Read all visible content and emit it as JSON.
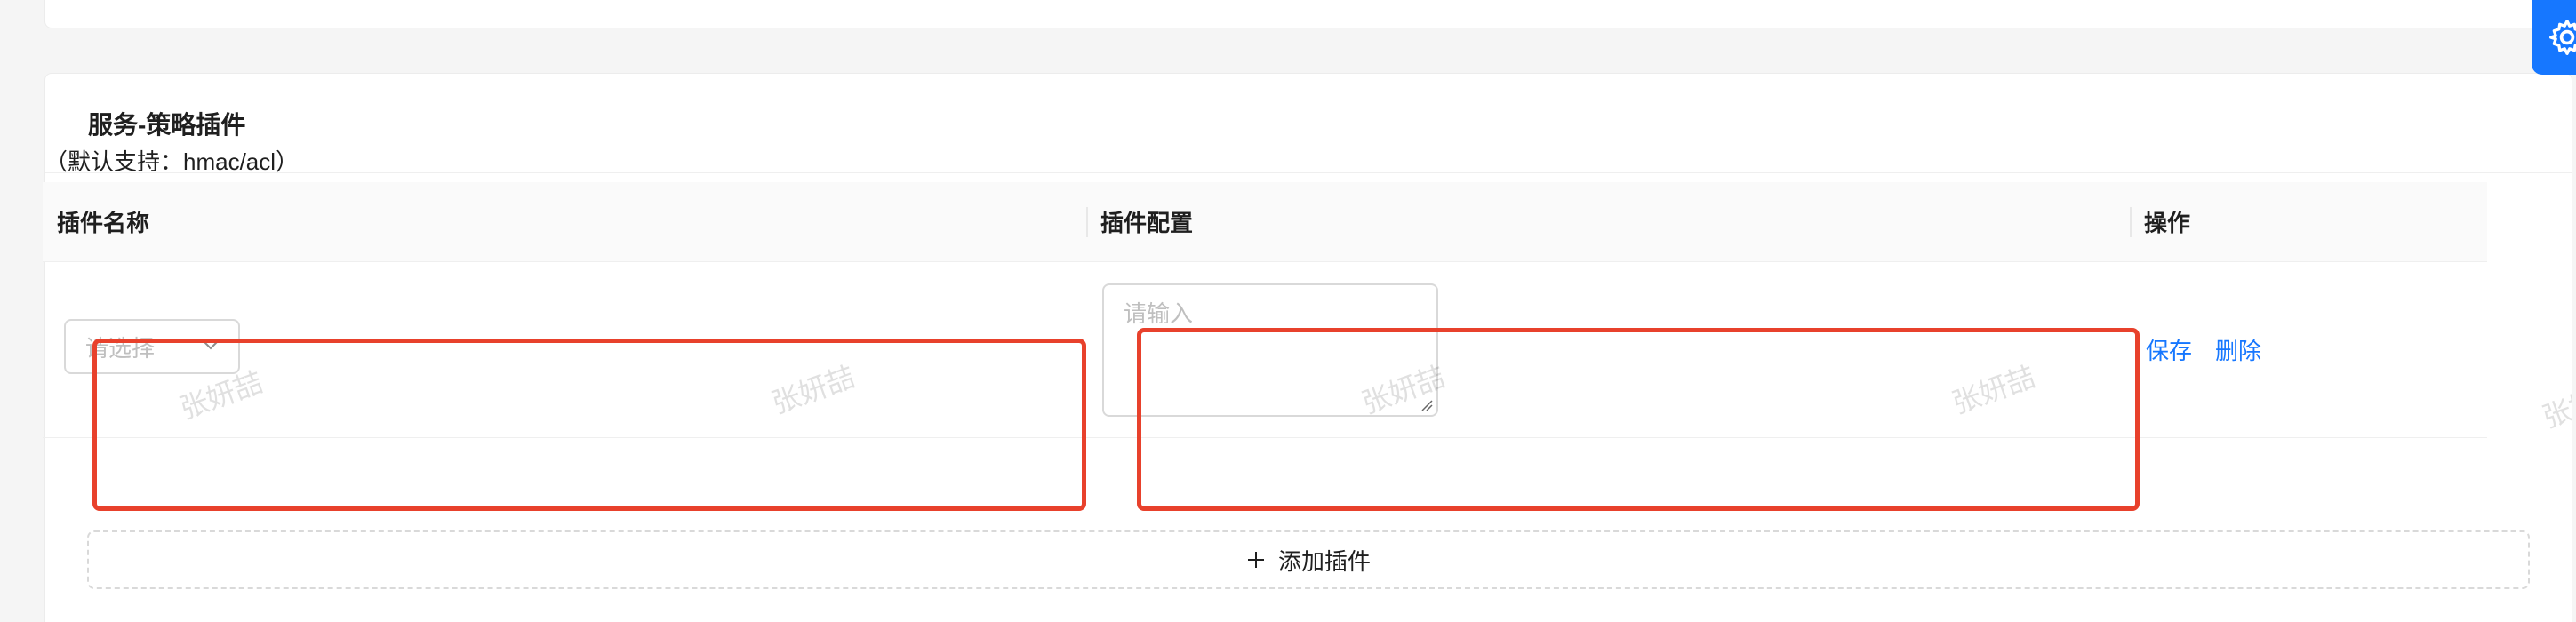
{
  "section": {
    "title": "服务-策略插件",
    "hint": "（默认支持：hmac/acl）"
  },
  "table": {
    "columns": [
      "插件名称",
      "插件配置",
      "操作"
    ],
    "rows": [
      {
        "plugin_select_placeholder": "请选择",
        "config_placeholder": "请输入",
        "actions": {
          "save": "保存",
          "delete": "删除"
        }
      }
    ]
  },
  "add_button": {
    "label": "添加插件"
  },
  "watermark": "张妍喆",
  "colors": {
    "primary": "#1677ff",
    "highlight": "#e8412c",
    "border": "#d9d9d9",
    "placeholder": "#bfbfbf"
  },
  "icons": [
    "chevron-down-icon",
    "resize-handle-icon",
    "plus-icon",
    "gear-icon"
  ]
}
